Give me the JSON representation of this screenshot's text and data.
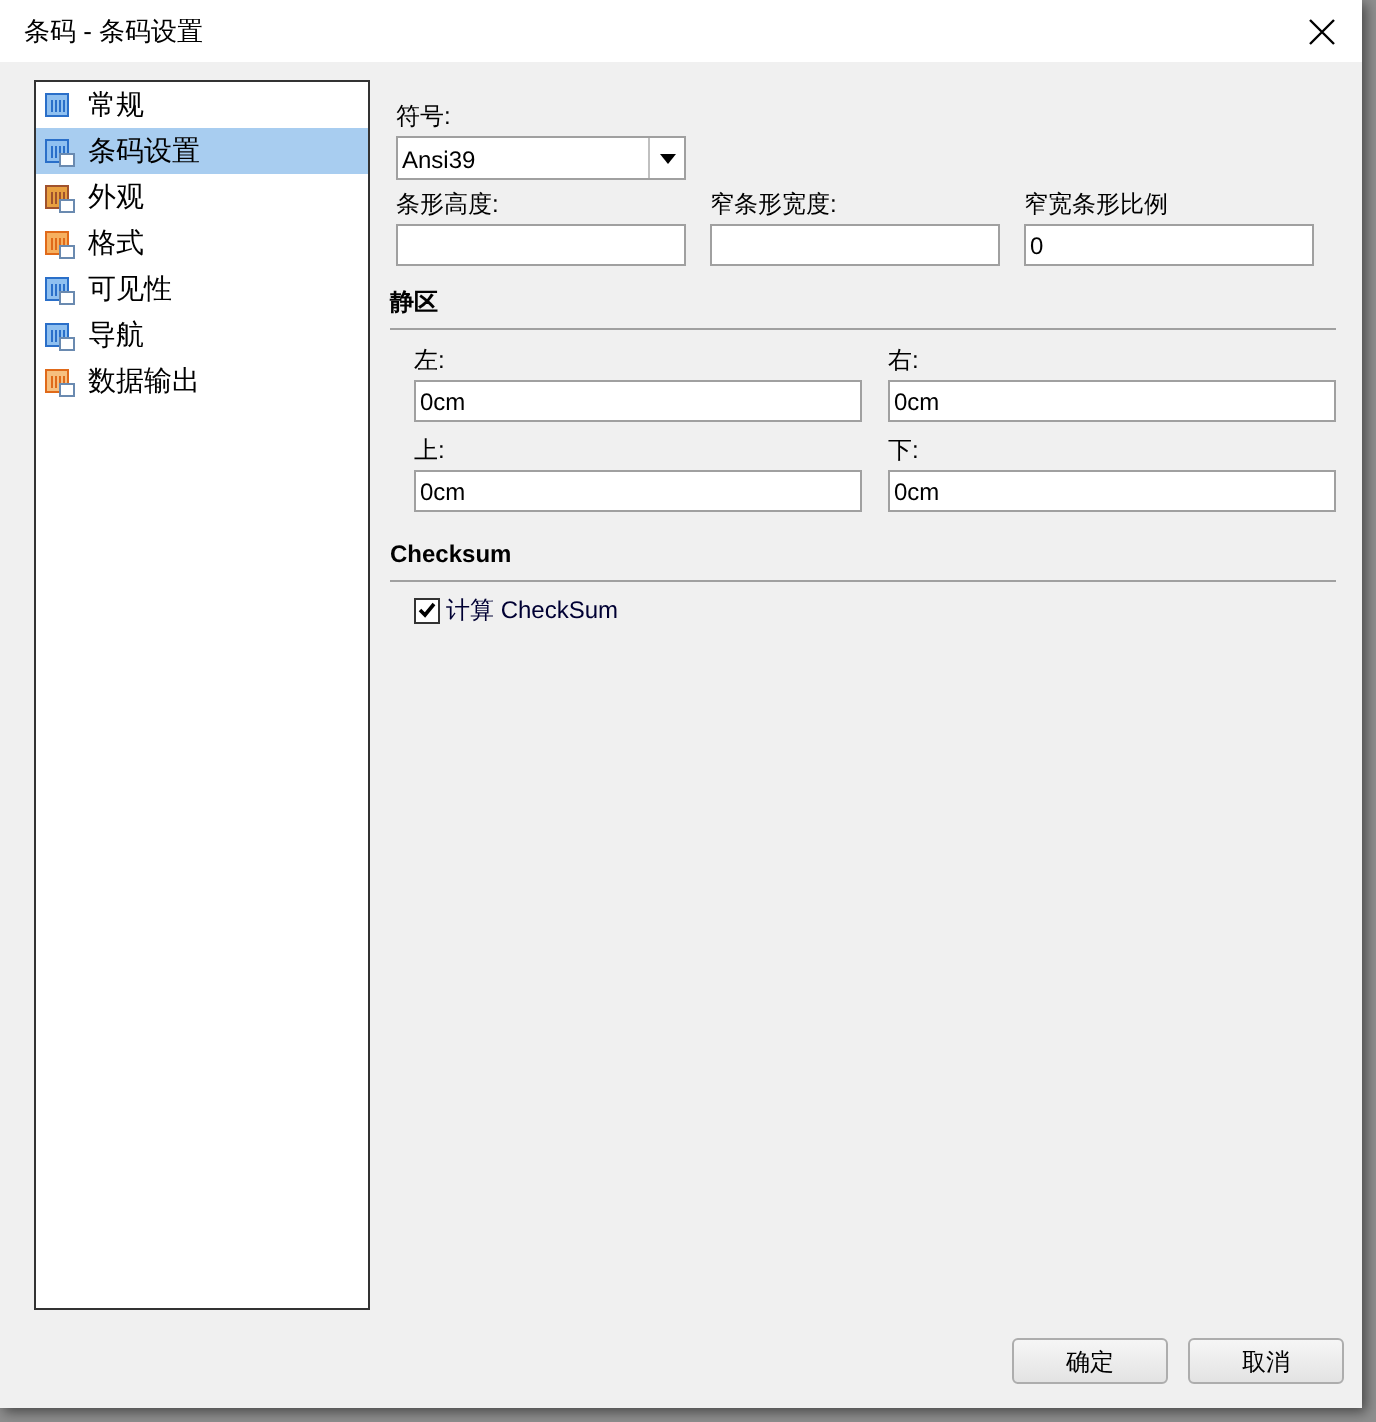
{
  "window": {
    "title": "条码 - 条码设置"
  },
  "sidebar": {
    "items": [
      {
        "label": "常规",
        "selected": false
      },
      {
        "label": "条码设置",
        "selected": true
      },
      {
        "label": "外观",
        "selected": false
      },
      {
        "label": "格式",
        "selected": false
      },
      {
        "label": "可见性",
        "selected": false
      },
      {
        "label": "导航",
        "selected": false
      },
      {
        "label": "数据输出",
        "selected": false
      }
    ]
  },
  "symbol": {
    "label": "符号:",
    "value": "Ansi39"
  },
  "bar_fields": [
    {
      "label": "条形高度:"
    },
    {
      "label": "窄条形宽度:"
    },
    {
      "label": "窄宽条形比例",
      "value": "0"
    }
  ],
  "quiet_zone": {
    "heading": "静区",
    "fields": [
      {
        "label": "左:",
        "value": "0cm"
      },
      {
        "label": "右:",
        "value": "0cm"
      },
      {
        "label": "上:",
        "value": "0cm"
      },
      {
        "label": "下:",
        "value": "0cm"
      }
    ]
  },
  "checksum": {
    "heading": "Checksum",
    "checkbox": {
      "label": "计算 CheckSum",
      "checked": true
    }
  },
  "buttons": [
    "确定",
    "取消"
  ]
}
